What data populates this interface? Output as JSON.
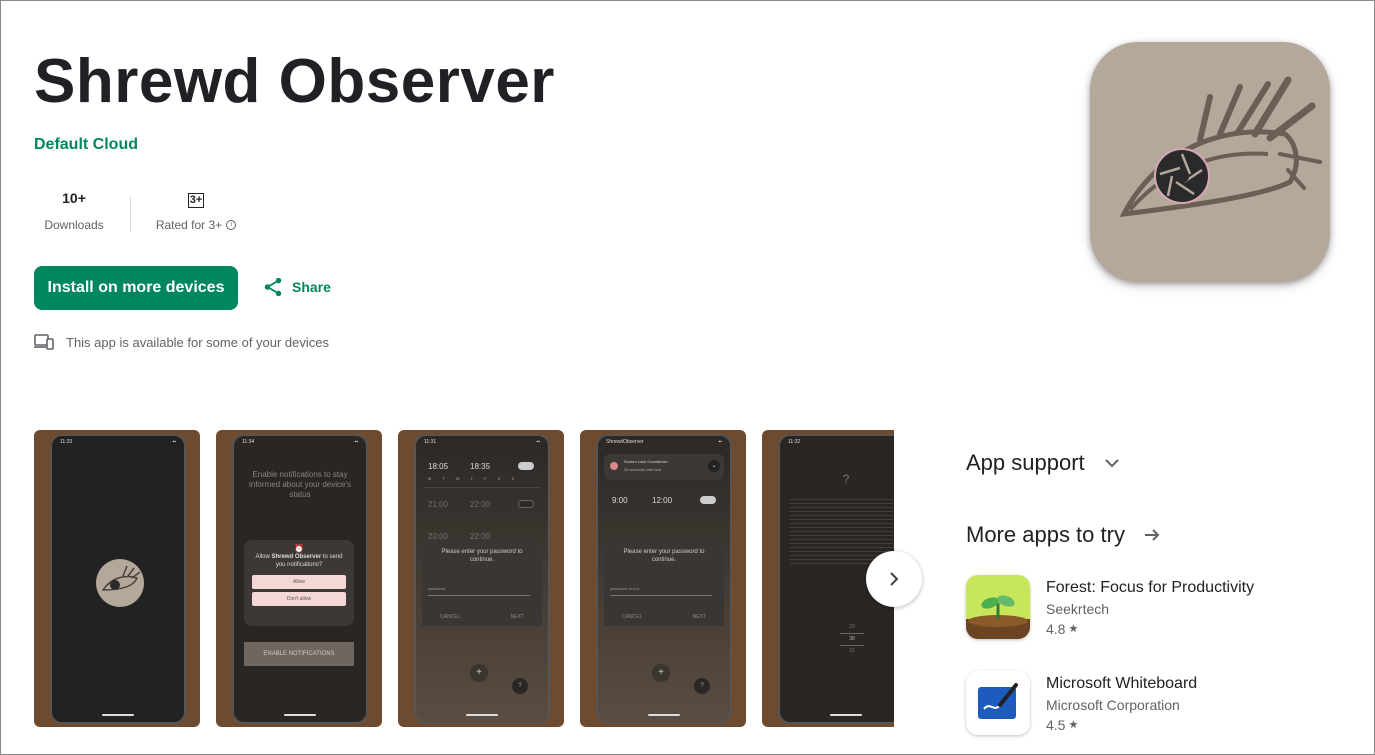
{
  "app": {
    "title": "Shrewd Observer",
    "developer": "Default Cloud"
  },
  "stats": {
    "downloads_value": "10+",
    "downloads_label": "Downloads",
    "rating_badge": "3+",
    "rated_label": "Rated for 3+"
  },
  "actions": {
    "install_label": "Install on more devices",
    "share_label": "Share"
  },
  "availability": "This app is available for some of your devices",
  "screenshots": {
    "s1": {
      "time": "11:33"
    },
    "s2": {
      "time": "11:34",
      "prompt": "Enable notifications to stay informed about your device's status",
      "dialog_pre": "Allow ",
      "dialog_app": "Shrewd Observer",
      "dialog_post": " to send you notifications?",
      "allow": "Allow",
      "deny": "Don't allow",
      "enable": "ENABLE NOTIFICATIONS"
    },
    "s3": {
      "time": "11:31",
      "rows": [
        [
          "18:05",
          "18:35"
        ],
        [
          "21:00",
          "22:00"
        ],
        [
          "20:00",
          "22:00"
        ]
      ],
      "days": "M T W T F S S",
      "prompt": "Please enter your password to continue.",
      "field": "password",
      "cancel": "CANCEL",
      "next": "NEXT"
    },
    "s4": {
      "app": "ShrewdObserver",
      "notif_title": "Screen Lock Countdown",
      "notif_body": "26 seconds until lock",
      "row": [
        "9:00",
        "12:00"
      ],
      "prompt": "Please enter your password to continue.",
      "field": "password",
      "field_value": "••••••••",
      "cancel": "CANCEL",
      "next": "NEXT"
    },
    "s5": {
      "time": "11:32",
      "mark": "?",
      "picker": [
        "29",
        "30",
        "31"
      ]
    }
  },
  "sidebar": {
    "app_support": "App support",
    "more_apps": "More apps to try"
  },
  "more_apps": [
    {
      "name": "Forest: Focus for Productivity",
      "developer": "Seekrtech",
      "rating": "4.8"
    },
    {
      "name": "Microsoft Whiteboard",
      "developer": "Microsoft Corporation",
      "rating": "4.5"
    }
  ],
  "colors": {
    "brand_green": "#01875f",
    "icon_bg": "#b3a89a",
    "screenshot_bg": "#6e4a2e"
  }
}
